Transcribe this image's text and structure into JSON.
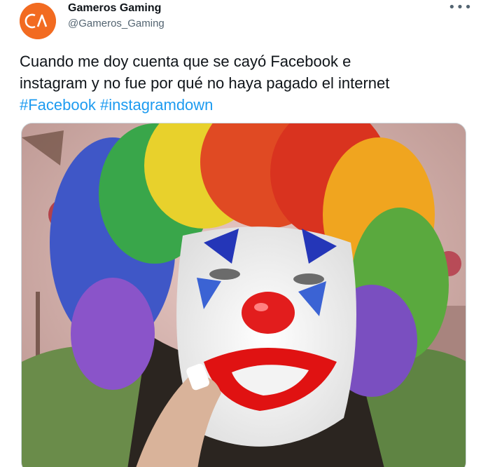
{
  "tweet": {
    "author_name": "Gameros Gaming",
    "author_handle": "@Gameros_Gaming",
    "more_icon": "more-icon",
    "text_line1": "Cuando me doy cuenta que se cayó Facebook e",
    "text_line2": "instagram y no fue por qué no haya pagado el internet",
    "hashtags": [
      "#Facebook",
      "#instagramdown"
    ],
    "media_description_icon": "photo"
  },
  "colors": {
    "accent": "#1d9bf0",
    "avatar_bg": "#f26b21",
    "text": "#0f1419",
    "secondary_text": "#536471"
  }
}
